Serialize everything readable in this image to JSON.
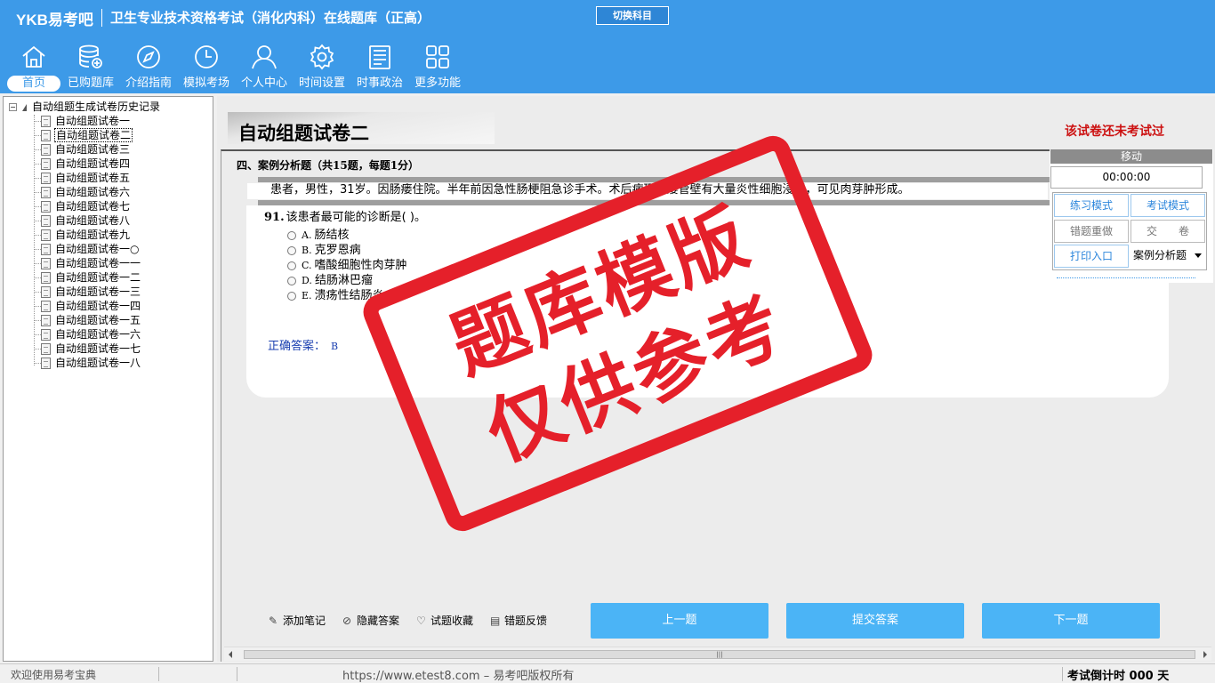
{
  "header": {
    "brand": "YKB易考吧",
    "title": "卫生专业技术资格考试（消化内科）在线题库（正高）",
    "switch_subject": "切换科目"
  },
  "nav": [
    {
      "label": "首页",
      "icon": "home-icon",
      "active": true
    },
    {
      "label": "已购题库",
      "icon": "database-icon"
    },
    {
      "label": "介绍指南",
      "icon": "compass-icon"
    },
    {
      "label": "模拟考场",
      "icon": "clock-icon"
    },
    {
      "label": "个人中心",
      "icon": "user-icon"
    },
    {
      "label": "时间设置",
      "icon": "gear-icon"
    },
    {
      "label": "时事政治",
      "icon": "news-icon"
    },
    {
      "label": "更多功能",
      "icon": "grid-icon"
    }
  ],
  "tree": {
    "root": "自动组题生成试卷历史记录",
    "items": [
      "自动组题试卷一",
      "自动组题试卷二",
      "自动组题试卷三",
      "自动组题试卷四",
      "自动组题试卷五",
      "自动组题试卷六",
      "自动组题试卷七",
      "自动组题试卷八",
      "自动组题试卷九",
      "自动组题试卷一○",
      "自动组题试卷一一",
      "自动组题试卷一二",
      "自动组题试卷一三",
      "自动组题试卷一四",
      "自动组题试卷一五",
      "自动组题试卷一六",
      "自动组题试卷一七",
      "自动组题试卷一八"
    ],
    "selected_index": 1
  },
  "paper": {
    "title": "自动组题试卷二",
    "status": "该试卷还未考试过",
    "section": "四、案例分析题（共15题，每题1分）",
    "case_text": "患者，男性，31岁。因肠瘘住院。半年前因急性肠梗阻急诊手术。术后病理：瘘管壁有大量炎性细胞浸润，可见肉芽肿形成。",
    "question": {
      "number": "91.",
      "stem": "该患者最可能的诊断是(    )。",
      "options": [
        {
          "letter": "A.",
          "text": "肠结核"
        },
        {
          "letter": "B.",
          "text": "克罗恩病"
        },
        {
          "letter": "C.",
          "text": "嗜酸细胞性肉芽肿"
        },
        {
          "letter": "D.",
          "text": "结肠淋巴瘤"
        },
        {
          "letter": "E.",
          "text": "溃疡性结肠炎"
        }
      ],
      "answer_label": "正确答案：",
      "answer_value": "B"
    }
  },
  "control": {
    "move": "移动",
    "timer": "00:00:00",
    "practice_mode": "练习模式",
    "exam_mode": "考试模式",
    "redo_wrong": "错题重做",
    "submit": "交　　卷",
    "print": "打印入口",
    "type_select": "案例分析题"
  },
  "tools": {
    "note": "添加笔记",
    "hide_answer": "隐藏答案",
    "favorite": "试题收藏",
    "feedback": "错题反馈"
  },
  "actions": {
    "prev": "上一题",
    "submit_answer": "提交答案",
    "next": "下一题"
  },
  "status": {
    "welcome": "欢迎使用易考宝典",
    "copyright": "https://www.etest8.com – 易考吧版权所有",
    "countdown": "考试倒计时 000 天"
  },
  "watermark": {
    "line1": "题库模版",
    "line2": "仅供参考"
  },
  "colors": {
    "header_bg": "#3d9ae8",
    "button_bg": "#4bb4f6",
    "stamp_red": "#e5202a",
    "status_red": "#cc1111"
  }
}
